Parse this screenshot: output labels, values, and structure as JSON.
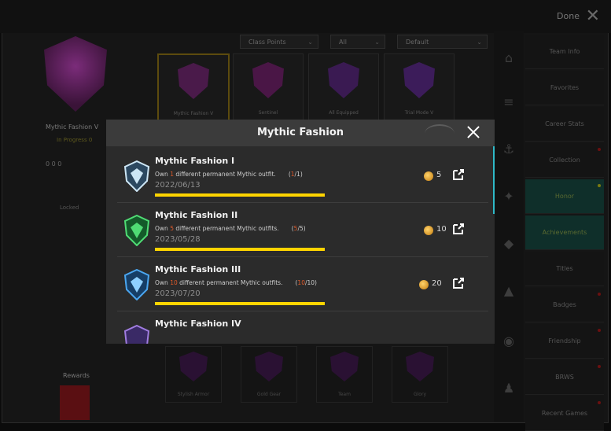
{
  "background": {
    "top_right": "Done",
    "left_panel": {
      "badge_title": "Mythic Fashion V",
      "badge_sub": "In Progress 0",
      "stats": "0  0  0",
      "extra": "",
      "label": "Locked"
    },
    "filters": [
      {
        "label": "Class Points"
      },
      {
        "label": "All"
      },
      {
        "label": "Default"
      }
    ],
    "cards": [
      {
        "label": "Mythic Fashion V"
      },
      {
        "label": "Sentinel"
      },
      {
        "label": "All Equipped"
      },
      {
        "label": "Trial Mode V"
      }
    ],
    "bottom_cards": [
      {
        "label": "Stylish Armor"
      },
      {
        "label": "Gold Gear"
      },
      {
        "label": "Team"
      },
      {
        "label": "Glory"
      }
    ],
    "rewards_label": "Rewards",
    "menu": [
      {
        "label": "Team Info"
      },
      {
        "label": "Favorites"
      },
      {
        "label": "Career Stats"
      },
      {
        "label": "Collection"
      },
      {
        "label": "Honor"
      },
      {
        "label": "Achievements"
      },
      {
        "label": "Titles"
      },
      {
        "label": "Badges"
      },
      {
        "label": "Friendship"
      },
      {
        "label": "BRWS"
      },
      {
        "label": "Recent Games"
      }
    ]
  },
  "modal": {
    "title": "Mythic Fashion",
    "achievements": [
      {
        "title": "Mythic Fashion I",
        "desc_pre": "Own",
        "desc_num": "1",
        "desc_post": "different permanent Mythic outfit.",
        "progress_current": "1",
        "progress_total": "1",
        "date": "2022/06/13",
        "progress_fraction": 1.0,
        "reward": "5",
        "badge_color": "#cde6f5"
      },
      {
        "title": "Mythic Fashion II",
        "desc_pre": "Own",
        "desc_num": "5",
        "desc_post": "different permanent Mythic outfits.",
        "progress_current": "5",
        "progress_total": "5",
        "date": "2023/05/28",
        "progress_fraction": 1.0,
        "reward": "10",
        "badge_color": "#4fdc74"
      },
      {
        "title": "Mythic Fashion III",
        "desc_pre": "Own",
        "desc_num": "10",
        "desc_post": "different permanent Mythic outfits.",
        "progress_current": "10",
        "progress_total": "10",
        "date": "2023/07/20",
        "progress_fraction": 1.0,
        "reward": "20",
        "badge_color": "#4aa6f0"
      },
      {
        "title": "Mythic Fashion IV",
        "badge_color": "#a07ce0"
      }
    ]
  }
}
